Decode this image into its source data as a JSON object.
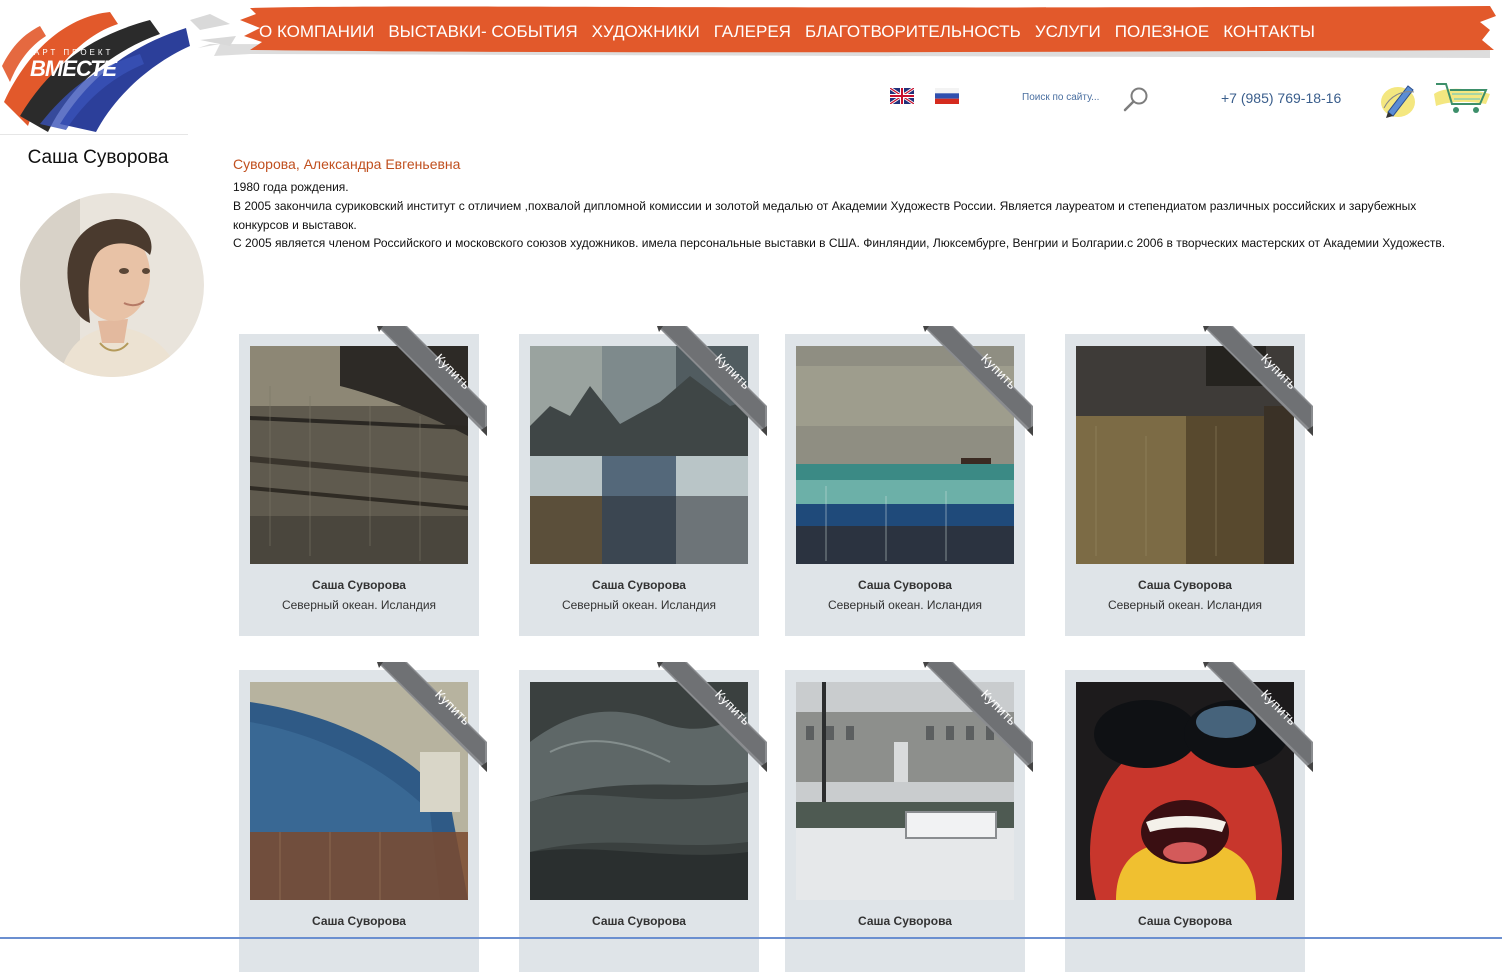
{
  "logo": {
    "main": "ВМЕСТЕ",
    "sub": "АРТ ПРОЕКТ"
  },
  "nav": {
    "items": [
      {
        "label": "О КОМПАНИИ"
      },
      {
        "label": "ВЫСТАВКИ- СОБЫТИЯ"
      },
      {
        "label": "ХУДОЖНИКИ"
      },
      {
        "label": "ГАЛЕРЕЯ"
      },
      {
        "label": "БЛАГОТВОРИТЕЛЬНОСТЬ"
      },
      {
        "label": "УСЛУГИ"
      },
      {
        "label": "ПОЛЕЗНОЕ"
      },
      {
        "label": "КОНТАКТЫ"
      }
    ]
  },
  "header": {
    "search_placeholder": "Поиск по сайту...",
    "phone": "+7 (985) 769-18-16",
    "flags": [
      "uk-flag-icon",
      "russia-flag-icon"
    ],
    "icons": [
      "search-icon",
      "pen-icon",
      "cart-icon"
    ],
    "accent_color": "#e2592b"
  },
  "sidebar": {
    "artist_name": "Саша Суворова"
  },
  "bio": {
    "title": "Суворова, Александра Евгеньевна",
    "paragraphs": [
      "1980 года рождения.",
      "В 2005 закончила суриковский институт с отличием ,похвалой дипломной комиссии и золотой медалью от Академии Художеств России. Является лауреатом и степендиатом различных российских и зарубежных конкурсов и выставок.",
      "С 2005 является членом Российского и московского союзов художников. имела персональные выставки в США. Финляндии, Люксембурге, Венгрии и Болгарии.с 2006 в творческих мастерских от Академии Художеств."
    ]
  },
  "gallery": {
    "ribbon_label": "Купить",
    "cards": [
      {
        "artist": "Саша Суворова",
        "title": "Северный океан. Исландия"
      },
      {
        "artist": "Саша Суворова",
        "title": "Северный океан. Исландия"
      },
      {
        "artist": "Саша Суворова",
        "title": "Северный океан. Исландия"
      },
      {
        "artist": "Саша Суворова",
        "title": "Северный океан. Исландия"
      },
      {
        "artist": "Саша Суворова",
        "title": ""
      },
      {
        "artist": "Саша Суворова",
        "title": ""
      },
      {
        "artist": "Саша Суворова",
        "title": ""
      },
      {
        "artist": "Саша Суворова",
        "title": ""
      }
    ]
  }
}
